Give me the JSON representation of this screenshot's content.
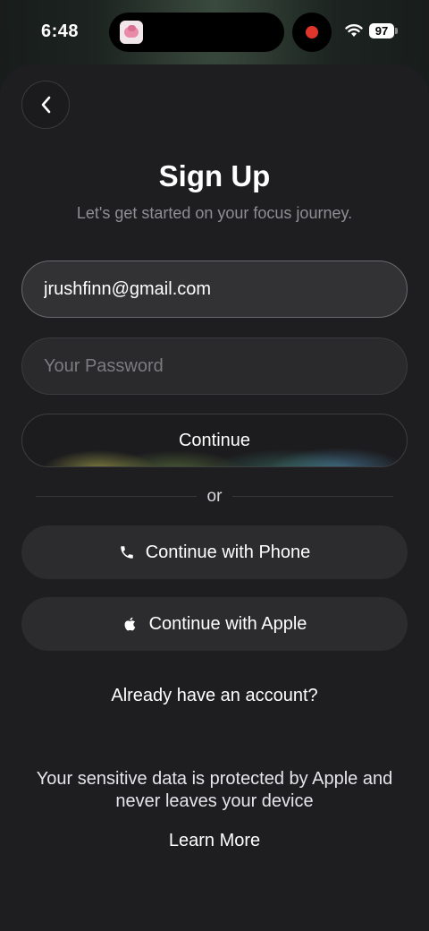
{
  "status_bar": {
    "time": "6:48",
    "battery": "97",
    "recording_color": "#e0352b"
  },
  "header": {
    "back_icon": "chevron-left-icon",
    "title": "Sign Up",
    "subtitle": "Let's get started on your focus journey."
  },
  "form": {
    "email_value": "jrushfinn@gmail.com",
    "password_placeholder": "Your Password",
    "continue_label": "Continue"
  },
  "divider": {
    "label": "or"
  },
  "social": {
    "phone_label": "Continue with Phone",
    "phone_icon": "phone-icon",
    "apple_label": "Continue with Apple",
    "apple_icon": "apple-icon"
  },
  "footer": {
    "login_link": "Already have an account?",
    "privacy_text": "Your sensitive data is protected by Apple and never leaves your device",
    "learn_more": "Learn More"
  }
}
